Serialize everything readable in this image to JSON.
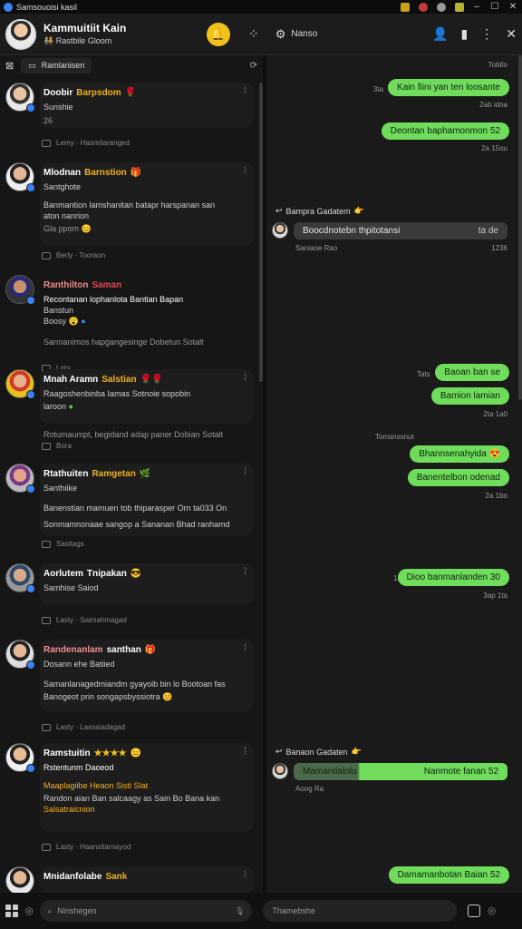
{
  "titlebar": {
    "title": "Samsouoisi kasil"
  },
  "header": {
    "name": "Kammuitiit Kain",
    "subtitle": "Rastbile Gloom",
    "room": "Nanso"
  },
  "left": {
    "tab_label": "Ramlanisen",
    "posts": [
      {
        "name": "Doobir",
        "tag": "Barpsdom",
        "tag_color": "#f2b01e",
        "lines": [
          "Sunshie",
          "26"
        ],
        "footer": "Lemy · Hasmitaranged"
      },
      {
        "name": "Mlodnan",
        "tag": "Barnstion",
        "tag_color": "#f2b01e",
        "lines": [
          "Santghote",
          "Banmantion lamshanitan batapr harspanan san",
          "aton nanrion",
          "Gla ppom"
        ],
        "footer": "Berly · Tooraon"
      },
      {
        "name": "Ranthilton",
        "tag": "Saman",
        "tag_color": "#e04848",
        "lines": [
          "Recontanan lophanlota Bantian Bapan",
          "Banstun",
          "Boosy"
        ],
        "footer": "Lory",
        "extra": "Sarmanimos hapgangesinge Dobetun Sotalt"
      },
      {
        "name": "Mnah Aramn",
        "tag": "Salstian",
        "tag_color": "#f2b01e",
        "lines": [
          "Raagoshenbinba Iamas      Sotnoie sopobin",
          "laroon"
        ],
        "footer": "Bora",
        "extra": "Rotumaumpt, begidand adap paner Dobian Sotalt"
      },
      {
        "name": "Rtathuiten",
        "tag": "Ramgetan",
        "tag_color": "#f2b01e",
        "lines": [
          "Santhiike"
        ],
        "footer": "Sasitags",
        "extra": "Banenstian mamuen tob thiparasper Orn ta033 On",
        "extra2": "Sonmamnonaae sangop a Sananan Bhad ranhamd"
      },
      {
        "name": "Aorlutem",
        "tag": "Tnipakan",
        "tag_color": "#ffffff",
        "lines": [
          "Samhise Saiod"
        ],
        "footer": "Lasty · Saimahmagad"
      },
      {
        "name": "Randenanlam",
        "tag": "santhan",
        "tag_color": "#ffffff",
        "lines": [
          "Dosann ehe Batiied",
          "Samanlanagedmiandm gyayoib bin lo Bootoan fas",
          "Banogeot prin songapsbyssiotra"
        ],
        "footer": "Lasty · Lassaiadagad",
        "name_color": "#f29090"
      },
      {
        "name": "Ramstuitin",
        "tag": "",
        "tag_color": "#f2c21b",
        "lines": [
          "Rstentunm Daoeod",
          "Maaplagiibe Heaon Sisti Slat",
          "Randon aian Ban salcaagy as Sain Bo Bana kan",
          "Salsatraicnion"
        ],
        "footer": "Lasty · Haansitarnayod",
        "stars": "★★★★"
      },
      {
        "name": "Mnidanfolabe",
        "tag": "Sank",
        "tag_color": "#f2b01e",
        "lines": [],
        "footer": ""
      }
    ]
  },
  "right": {
    "top_time": "Tobtlo",
    "messages": [
      {
        "side": "out",
        "text": "Kain fiini yan ten loosante",
        "time": "3ta",
        "stamp": "2ab idna"
      },
      {
        "side": "out",
        "text": "Deontan baphamonmon 52",
        "stamp": "2a 15ou"
      },
      {
        "side": "in",
        "sender": "Bampra Gadatem",
        "text": "Boocdnotebn thpitotansi",
        "meta": "ta de",
        "stamp": "Saniaoe Rao"
      },
      {
        "side": "out",
        "text": "Baoan ban se",
        "time": "Tats"
      },
      {
        "side": "out",
        "text": "Bamion lamian",
        "stamp": "2ta 1a0"
      },
      {
        "side": "out",
        "label": "Tomsnssnut",
        "text": "Bhannsenahyida"
      },
      {
        "side": "out",
        "text": "Banentelbon odenad",
        "stamp": "2a 1bo"
      },
      {
        "side": "out",
        "text": "Dioo banmanlanden 30",
        "time": "1a",
        "stamp": "3ap 1ta"
      },
      {
        "side": "in",
        "sender": "Banaon Gadaten",
        "text": "Mamantialolu",
        "text2": "Nanmote fanan 52",
        "stamp": "Aoog Ra"
      },
      {
        "side": "out",
        "text": "Damamanbotan Baian 52"
      }
    ]
  },
  "bottom": {
    "search_placeholder": "Ninshegen",
    "compose_placeholder": "Thamebshe"
  }
}
